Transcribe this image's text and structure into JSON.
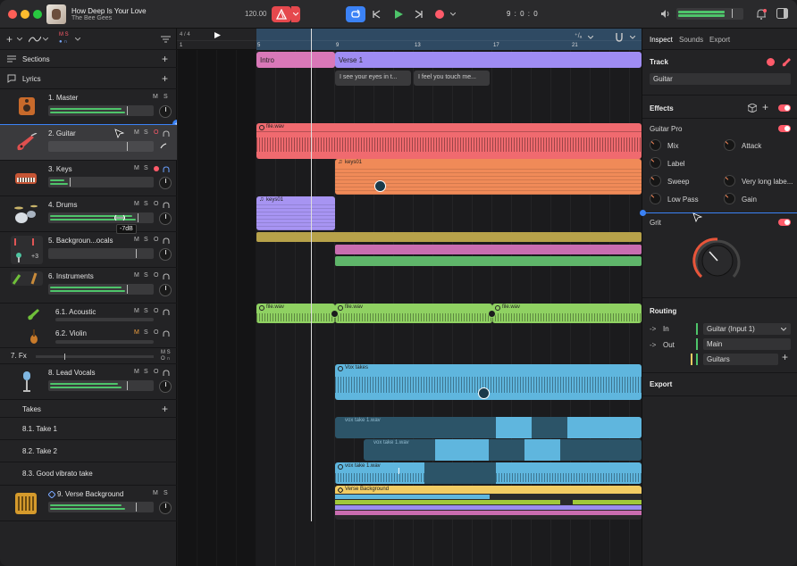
{
  "window": {
    "song_title": "How Deep Is Your Love",
    "artist": "The Bee Gees",
    "tempo": "120.00",
    "time_display": "9 : 0 : 0",
    "signature": "4 / 4"
  },
  "left": {
    "sections_label": "Sections",
    "lyrics_label": "Lyrics",
    "m": "M",
    "s": "S",
    "o": "O",
    "tracks": [
      {
        "name": "1. Master"
      },
      {
        "name": "2. Guitar"
      },
      {
        "name": "3. Keys"
      },
      {
        "name": "4. Drums",
        "tooltip": "-7dB"
      },
      {
        "name": "5. Backgroun...ocals",
        "extra": "+3"
      },
      {
        "name": "6. Instruments"
      },
      {
        "name": "6.1. Acoustic"
      },
      {
        "name": "6.2. Violin"
      },
      {
        "name": "7. Fx"
      },
      {
        "name": "8. Lead Vocals"
      },
      {
        "name": "9. Verse Background"
      }
    ],
    "takes_label": "Takes",
    "takes": [
      "8.1. Take 1",
      "8.2. Take 2",
      "8.3. Good vibrato take"
    ]
  },
  "timeline": {
    "ruler": [
      "1",
      "5",
      "9",
      "13",
      "17",
      "21"
    ],
    "sections": [
      "Intro",
      "Verse 1"
    ],
    "lyrics": [
      "I see your eyes in t...",
      "I feel you touch me..."
    ],
    "clips": {
      "guitar": "file.wav",
      "keys": "keys01",
      "keys_purple": "keys01",
      "acoustic": [
        "file.wav",
        "file.wav",
        "file.wav"
      ],
      "vox": "Vox takes",
      "take1": "vox take 1.wav",
      "take2": "vox take 1.wav",
      "take3": "vox take 1.wav",
      "verse_bg": "Verse Background"
    }
  },
  "right": {
    "tabs": [
      "Inspect",
      "Sounds",
      "Export"
    ],
    "track_label": "Track",
    "track_value": "Guitar",
    "effects_label": "Effects",
    "plugin1": "Guitar Pro",
    "params": [
      "Mix",
      "Attack",
      "Label",
      "Sweep",
      "Very long labe...",
      "Low Pass",
      "Gain"
    ],
    "plugin2": "Grit",
    "routing_label": "Routing",
    "in_label": "In",
    "in_value": "Guitar (Input 1)",
    "out_label": "Out",
    "out_value": "Main",
    "bus_value": "Guitars",
    "export_label": "Export"
  },
  "colors": {
    "intro": "#d978b8",
    "verse": "#9f8cf3",
    "guitar": "#f06a6f",
    "keys": "#f08a58",
    "purple": "#a794f2",
    "olive": "#b7a24a",
    "pink": "#c96db0",
    "green": "#5fb56a",
    "lime": "#8fd162",
    "vox": "#5fb6de",
    "yellow": "#f2cc63",
    "accent": "#ff5b6a"
  }
}
